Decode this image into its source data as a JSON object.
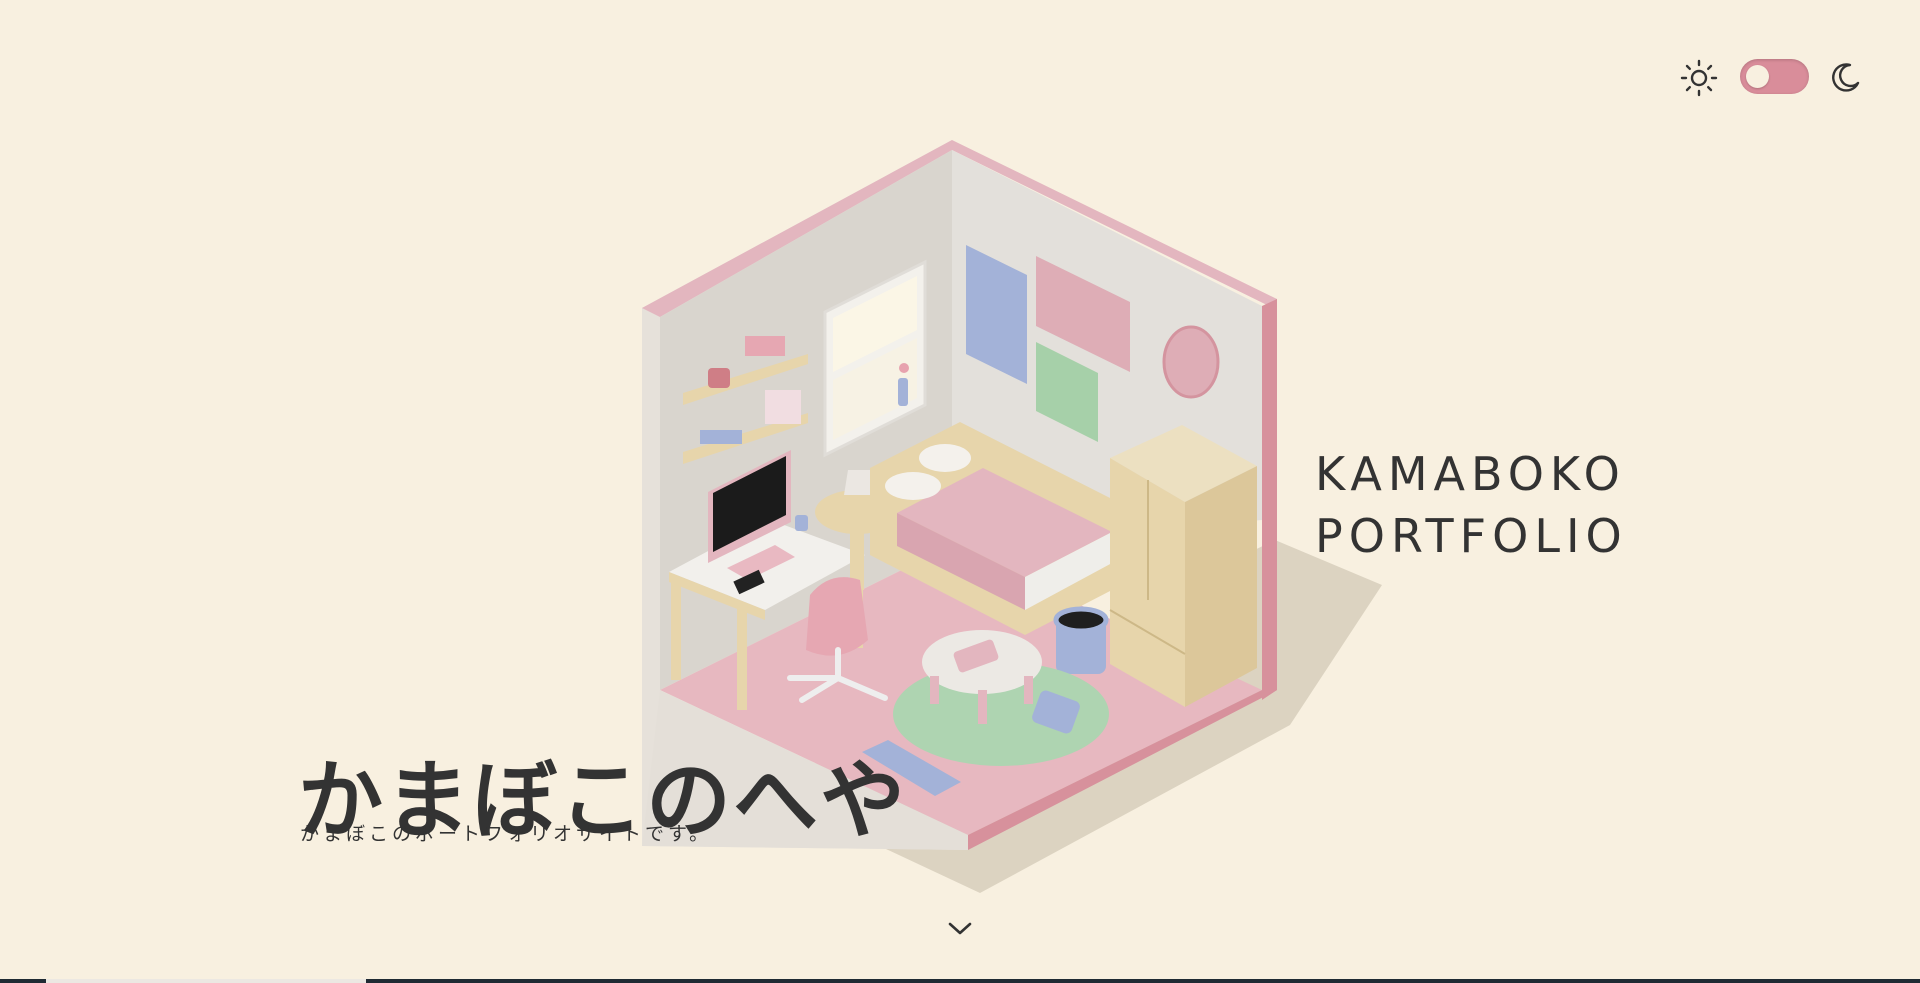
{
  "theme": {
    "toggle_state": "light",
    "icons": [
      "sun-icon",
      "moon-icon"
    ],
    "accent": "#d98d9a"
  },
  "hero": {
    "brand_line1": "KAMABOKO",
    "brand_line2": "PORTFOLIO",
    "title": "かまぼこのへや",
    "subtitle": "かまぼこのポートフォリオサイトです。"
  },
  "scroll_icon": "chevron-down-icon",
  "colors": {
    "background": "#f8f0e0",
    "text": "#333333",
    "pink": "#e3b6bf",
    "blue": "#a3b2d8",
    "green": "#a6d0a9",
    "wood": "#e7d5ab"
  }
}
